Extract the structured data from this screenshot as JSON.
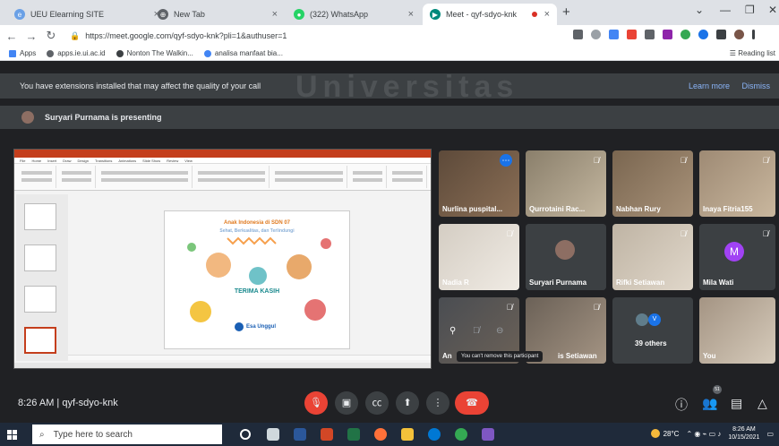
{
  "browser": {
    "tabs": [
      {
        "label": "UEU Elearning SITE",
        "icon_color": "#6aa0e6"
      },
      {
        "label": "New Tab",
        "icon_color": "#5f6368"
      },
      {
        "label": "(322) WhatsApp",
        "icon_color": "#25d366"
      },
      {
        "label": "Meet - qyf-sdyo-knk",
        "icon_color": "#00897b"
      }
    ],
    "new_tab_glyph": "+",
    "url": "https://meet.google.com/qyf-sdyo-knk?pli=1&authuser=1",
    "bookmarks": [
      "Apps",
      "apps.ie.ui.ac.id",
      "Nonton The Walkin...",
      "analisa manfaat bia..."
    ],
    "reading_list": "Reading list"
  },
  "watermark": "Universitas",
  "meet": {
    "notice_text": "You have extensions installed that may affect the quality of your call",
    "learn_more": "Learn more",
    "dismiss": "Dismiss",
    "presenting": "Suryari Purnama is presenting",
    "slide": {
      "title": "Anak Indonesia di SDN 07",
      "subtitle": "Sehat, Berkualitas, dan Terlindungi",
      "thanks": "TERIMA KASIH",
      "logo": "Esa Unggul"
    },
    "participants": [
      {
        "name": "Nurlina puspital...",
        "bg": "#6d5a4a"
      },
      {
        "name": "Qurrotaini Rac...",
        "bg": "#8a7f6b"
      },
      {
        "name": "Nabhan Rury",
        "bg": "#7a6650"
      },
      {
        "name": "Inaya Fitria155",
        "bg": "#9e8a74"
      },
      {
        "name": "Nadia R",
        "bg": "#c9c2b8"
      },
      {
        "name": "Suryari Purnama",
        "bg": "#3c4043"
      },
      {
        "name": "Rifki Setiawan",
        "bg": "#bfb4a4"
      },
      {
        "name": "Mila Wati",
        "bg": "#3c4043",
        "initial": "M"
      },
      {
        "name": "An",
        "bg": "#4a4d52"
      },
      {
        "name": "is Setiawan",
        "bg": "#6b6157"
      },
      {
        "name": "39 others",
        "bg": "#3c4043"
      },
      {
        "name": "You",
        "bg": "#a49483"
      }
    ],
    "tooltip": "You can't remove this participant",
    "clock": "8:26 AM",
    "meeting_code": "qyf-sdyo-knk",
    "people_count": "51"
  },
  "taskbar": {
    "search_placeholder": "Type here to search",
    "weather": "28°C",
    "time": "8:26 AM",
    "date": "10/15/2021"
  }
}
